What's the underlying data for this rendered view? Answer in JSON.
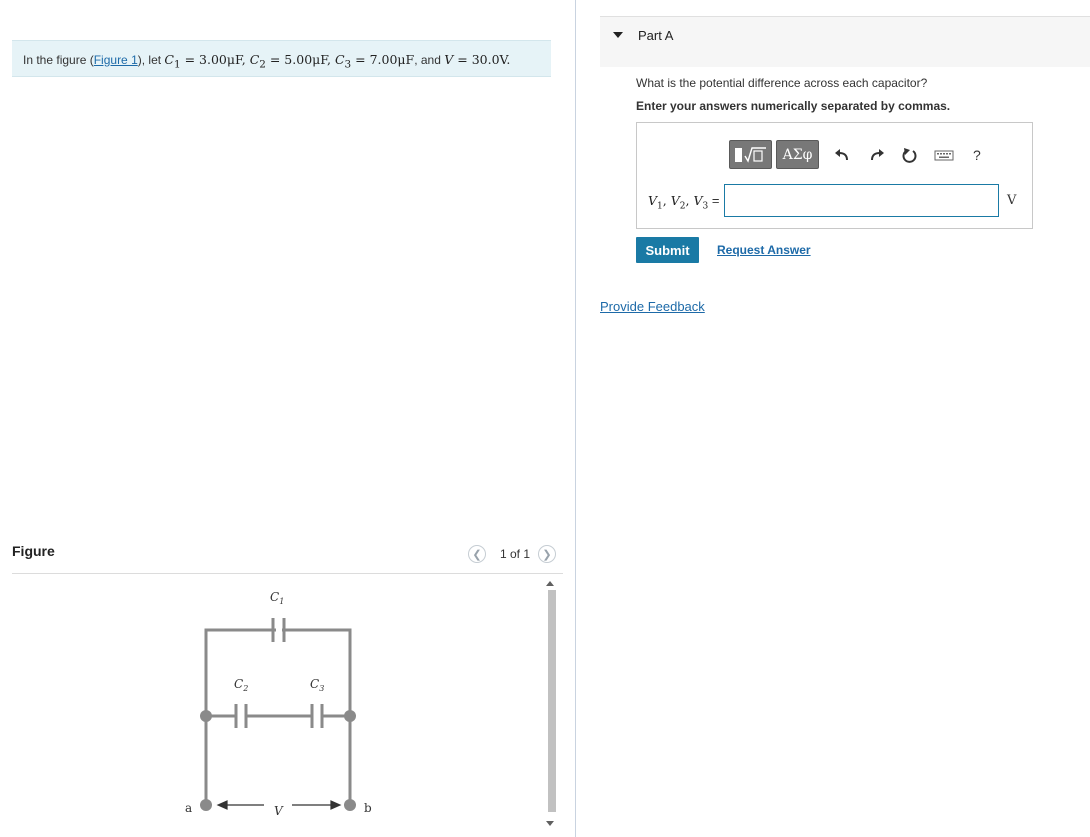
{
  "problem": {
    "prefix": "In the figure (",
    "figure_link": "Figure 1",
    "after_link": "), let ",
    "c1": "C",
    "c1_sub": "1",
    "c1_val": " = 3.00μF, ",
    "c2": "C",
    "c2_sub": "2",
    "c2_val": " = 5.00μF, ",
    "c3": "C",
    "c3_sub": "3",
    "c3_val": " = 7.00μF",
    "and": ", and ",
    "v": "V",
    "v_val": " = 30.0V."
  },
  "figure": {
    "title": "Figure",
    "pager": "1 of 1",
    "prev_icon": "chevron-left-icon",
    "next_icon": "chevron-right-icon",
    "labels": {
      "c1": "C",
      "c1_sub": "1",
      "c2": "C",
      "c2_sub": "2",
      "c3": "C",
      "c3_sub": "3",
      "a": "a",
      "b": "b",
      "v": "V"
    },
    "wire_color": "#8a8a8a"
  },
  "part": {
    "title": "Part A",
    "question": "What is the potential difference across each capacitor?",
    "instruction": "Enter your answers numerically separated by commas.",
    "toolbar": {
      "template_icon": "fraction-sqrt-template-icon",
      "symbols_label": "ΑΣφ",
      "undo_icon": "undo-icon",
      "redo_icon": "redo-icon",
      "reset_icon": "reset-icon",
      "keyboard_icon": "keyboard-icon",
      "help_label": "?"
    },
    "answer": {
      "v1": "V",
      "v1_sub": "1",
      "v2": "V",
      "v2_sub": "2",
      "v3": "V",
      "v3_sub": "3",
      "equals": " =",
      "value": "",
      "unit": "V"
    },
    "submit_label": "Submit",
    "request_label": "Request Answer"
  },
  "feedback_label": "Provide Feedback",
  "colors": {
    "accent": "#1a7aa5",
    "link": "#1d6aa8",
    "problem_bg": "#e6f3f7"
  }
}
